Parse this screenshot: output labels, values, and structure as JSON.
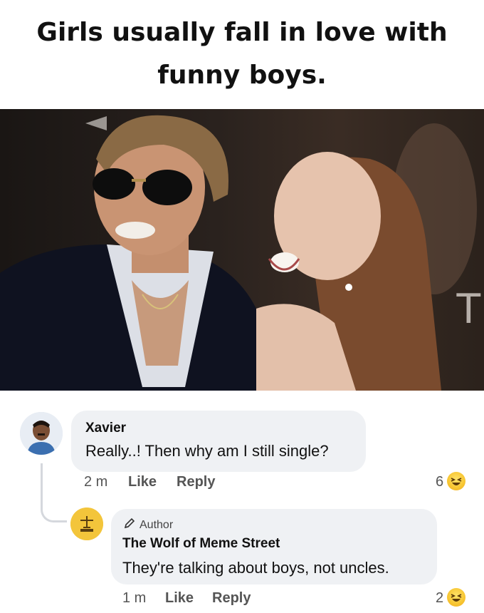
{
  "caption": {
    "line1": "Girls usually fall in love with",
    "line2": "funny boys."
  },
  "comments": [
    {
      "author": "Xavier",
      "text": "Really..! Then why am I still single?",
      "time": "2 m",
      "like_label": "Like",
      "reply_label": "Reply",
      "reaction_count": "6",
      "reaction_icon": "haha-emoji-icon"
    },
    {
      "badge": "Author",
      "badge_icon": "pencil-icon",
      "author": "The Wolf of Meme Street",
      "text": "They're talking about boys, not uncles.",
      "time": "1 m",
      "like_label": "Like",
      "reply_label": "Reply",
      "reaction_count": "2",
      "reaction_icon": "haha-emoji-icon"
    }
  ],
  "colors": {
    "bubble": "#eff1f4",
    "thread_line": "#d5d8dd",
    "reaction": "#f7c531"
  }
}
